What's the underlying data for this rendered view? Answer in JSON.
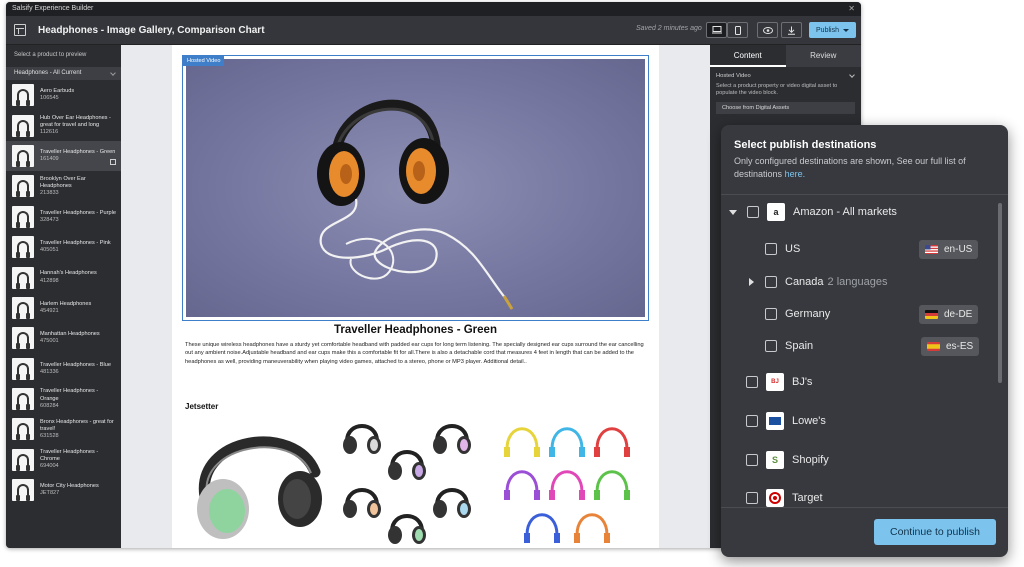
{
  "app": {
    "window_title": "Salsify Experience Builder",
    "doc_title": "Headphones - Image Gallery, Comparison Chart",
    "saved_status": "Saved 2 minutes ago",
    "publish_label": "Publish"
  },
  "sidebar": {
    "prompt": "Select a product to preview",
    "select_value": "Headphones - All Current",
    "items": [
      {
        "name": "Aero Earbuds",
        "sku": "106545"
      },
      {
        "name": "Hub Over Ear Headphones - great for travel and long",
        "sku": "112616"
      },
      {
        "name": "Traveller Headphones - Green",
        "sku": "161409"
      },
      {
        "name": "Brooklyn Over Ear Headphones",
        "sku": "213833"
      },
      {
        "name": "Traveller Headphones - Purple",
        "sku": "328473"
      },
      {
        "name": "Traveller Headphones - Pink",
        "sku": "405051"
      },
      {
        "name": "Hannah's Headphones",
        "sku": "412898"
      },
      {
        "name": "Harlem Headphones",
        "sku": "454921"
      },
      {
        "name": "Manhattan Headphones",
        "sku": "475001"
      },
      {
        "name": "Traveller Headphones - Blue",
        "sku": "481336"
      },
      {
        "name": "Traveller Headphones - Orange",
        "sku": "608284"
      },
      {
        "name": "Bronx Headphones - great for travel!",
        "sku": "631528"
      },
      {
        "name": "Traveller Headphones - Chrome",
        "sku": "694004"
      },
      {
        "name": "Motor City Headphones",
        "sku": "JET827"
      }
    ]
  },
  "canvas": {
    "video_tag": "Hosted Video",
    "product_title": "Traveller Headphones - Green",
    "description": "These unique wireless headphones have a sturdy yet comfortable headband with padded ear cups for long term listening. The specially designed ear cups surround the ear cancelling out any ambient noise.Adjustable headband and ear cups make this a comfortable fit for all.There is also a detachable cord that measures 4 feet in length that can be added to the headphones as well, providing maneuverability when playing video games, attached to a stereo, phone or MP3 player. Additional detail..",
    "section_title": "Jetsetter"
  },
  "right_panel": {
    "tab_content": "Content",
    "tab_review": "Review",
    "section": "Hosted Video",
    "help": "Select a product property or video digital asset to populate the video block.",
    "select": "Choose from Digital Assets"
  },
  "modal": {
    "title": "Select publish destinations",
    "subtitle": "Only configured destinations are shown, See our full list of destinations",
    "subtitle_link": "here.",
    "amazon": "Amazon - All markets",
    "us": "US",
    "us_locale": "en-US",
    "canada": "Canada",
    "canada_langs": "2 languages",
    "germany": "Germany",
    "de_locale": "de-DE",
    "spain": "Spain",
    "es_locale": "es-ES",
    "bjs": "BJ's",
    "lowes": "Lowe's",
    "shopify": "Shopify",
    "target": "Target",
    "continue": "Continue to publish"
  },
  "colors": {
    "accent": "#7cc4ee",
    "selection_blue": "#3f7fc9",
    "panel_dark": "#2b2d31",
    "modal_bg": "#37393e"
  }
}
